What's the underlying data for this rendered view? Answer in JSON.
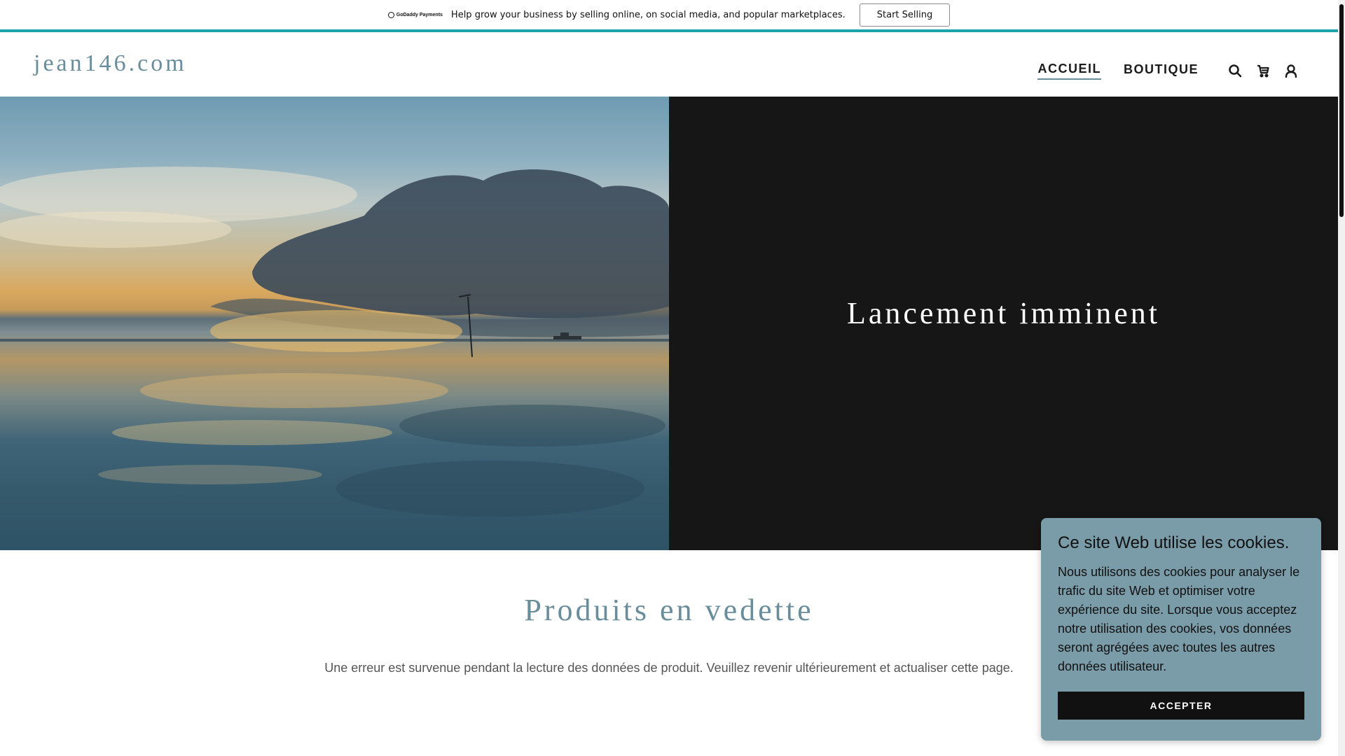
{
  "promo": {
    "logo_text": "GoDaddy Payments",
    "text": "Help grow your business by selling online, on social media, and popular marketplaces.",
    "button_label": "Start Selling"
  },
  "header": {
    "site_title": "jean146.com",
    "nav": [
      {
        "label": "ACCUEIL",
        "active": true
      },
      {
        "label": "BOUTIQUE",
        "active": false
      }
    ],
    "icons": [
      "search-icon",
      "cart-icon",
      "account-icon"
    ]
  },
  "hero": {
    "heading": "Lancement imminent"
  },
  "featured": {
    "title": "Produits en vedette",
    "message": "Une erreur est survenue pendant la lecture des données de produit. Veuillez revenir ultérieurement et actualiser cette page."
  },
  "cookie": {
    "title": "Ce site Web utilise les cookies.",
    "body": "Nous utilisons des cookies pour analyser le trafic du site Web et optimiser votre expérience du site. Lorsque vous acceptez notre utilisation des cookies, vos données seront agrégées avec toutes les autres données utilisateur.",
    "accept_label": "ACCEPTER"
  },
  "colors": {
    "accent": "#6a8d9b",
    "banner_border": "#1aa3a8",
    "hero_panel": "#161616",
    "cookie_bg": "#7a9ba8"
  }
}
